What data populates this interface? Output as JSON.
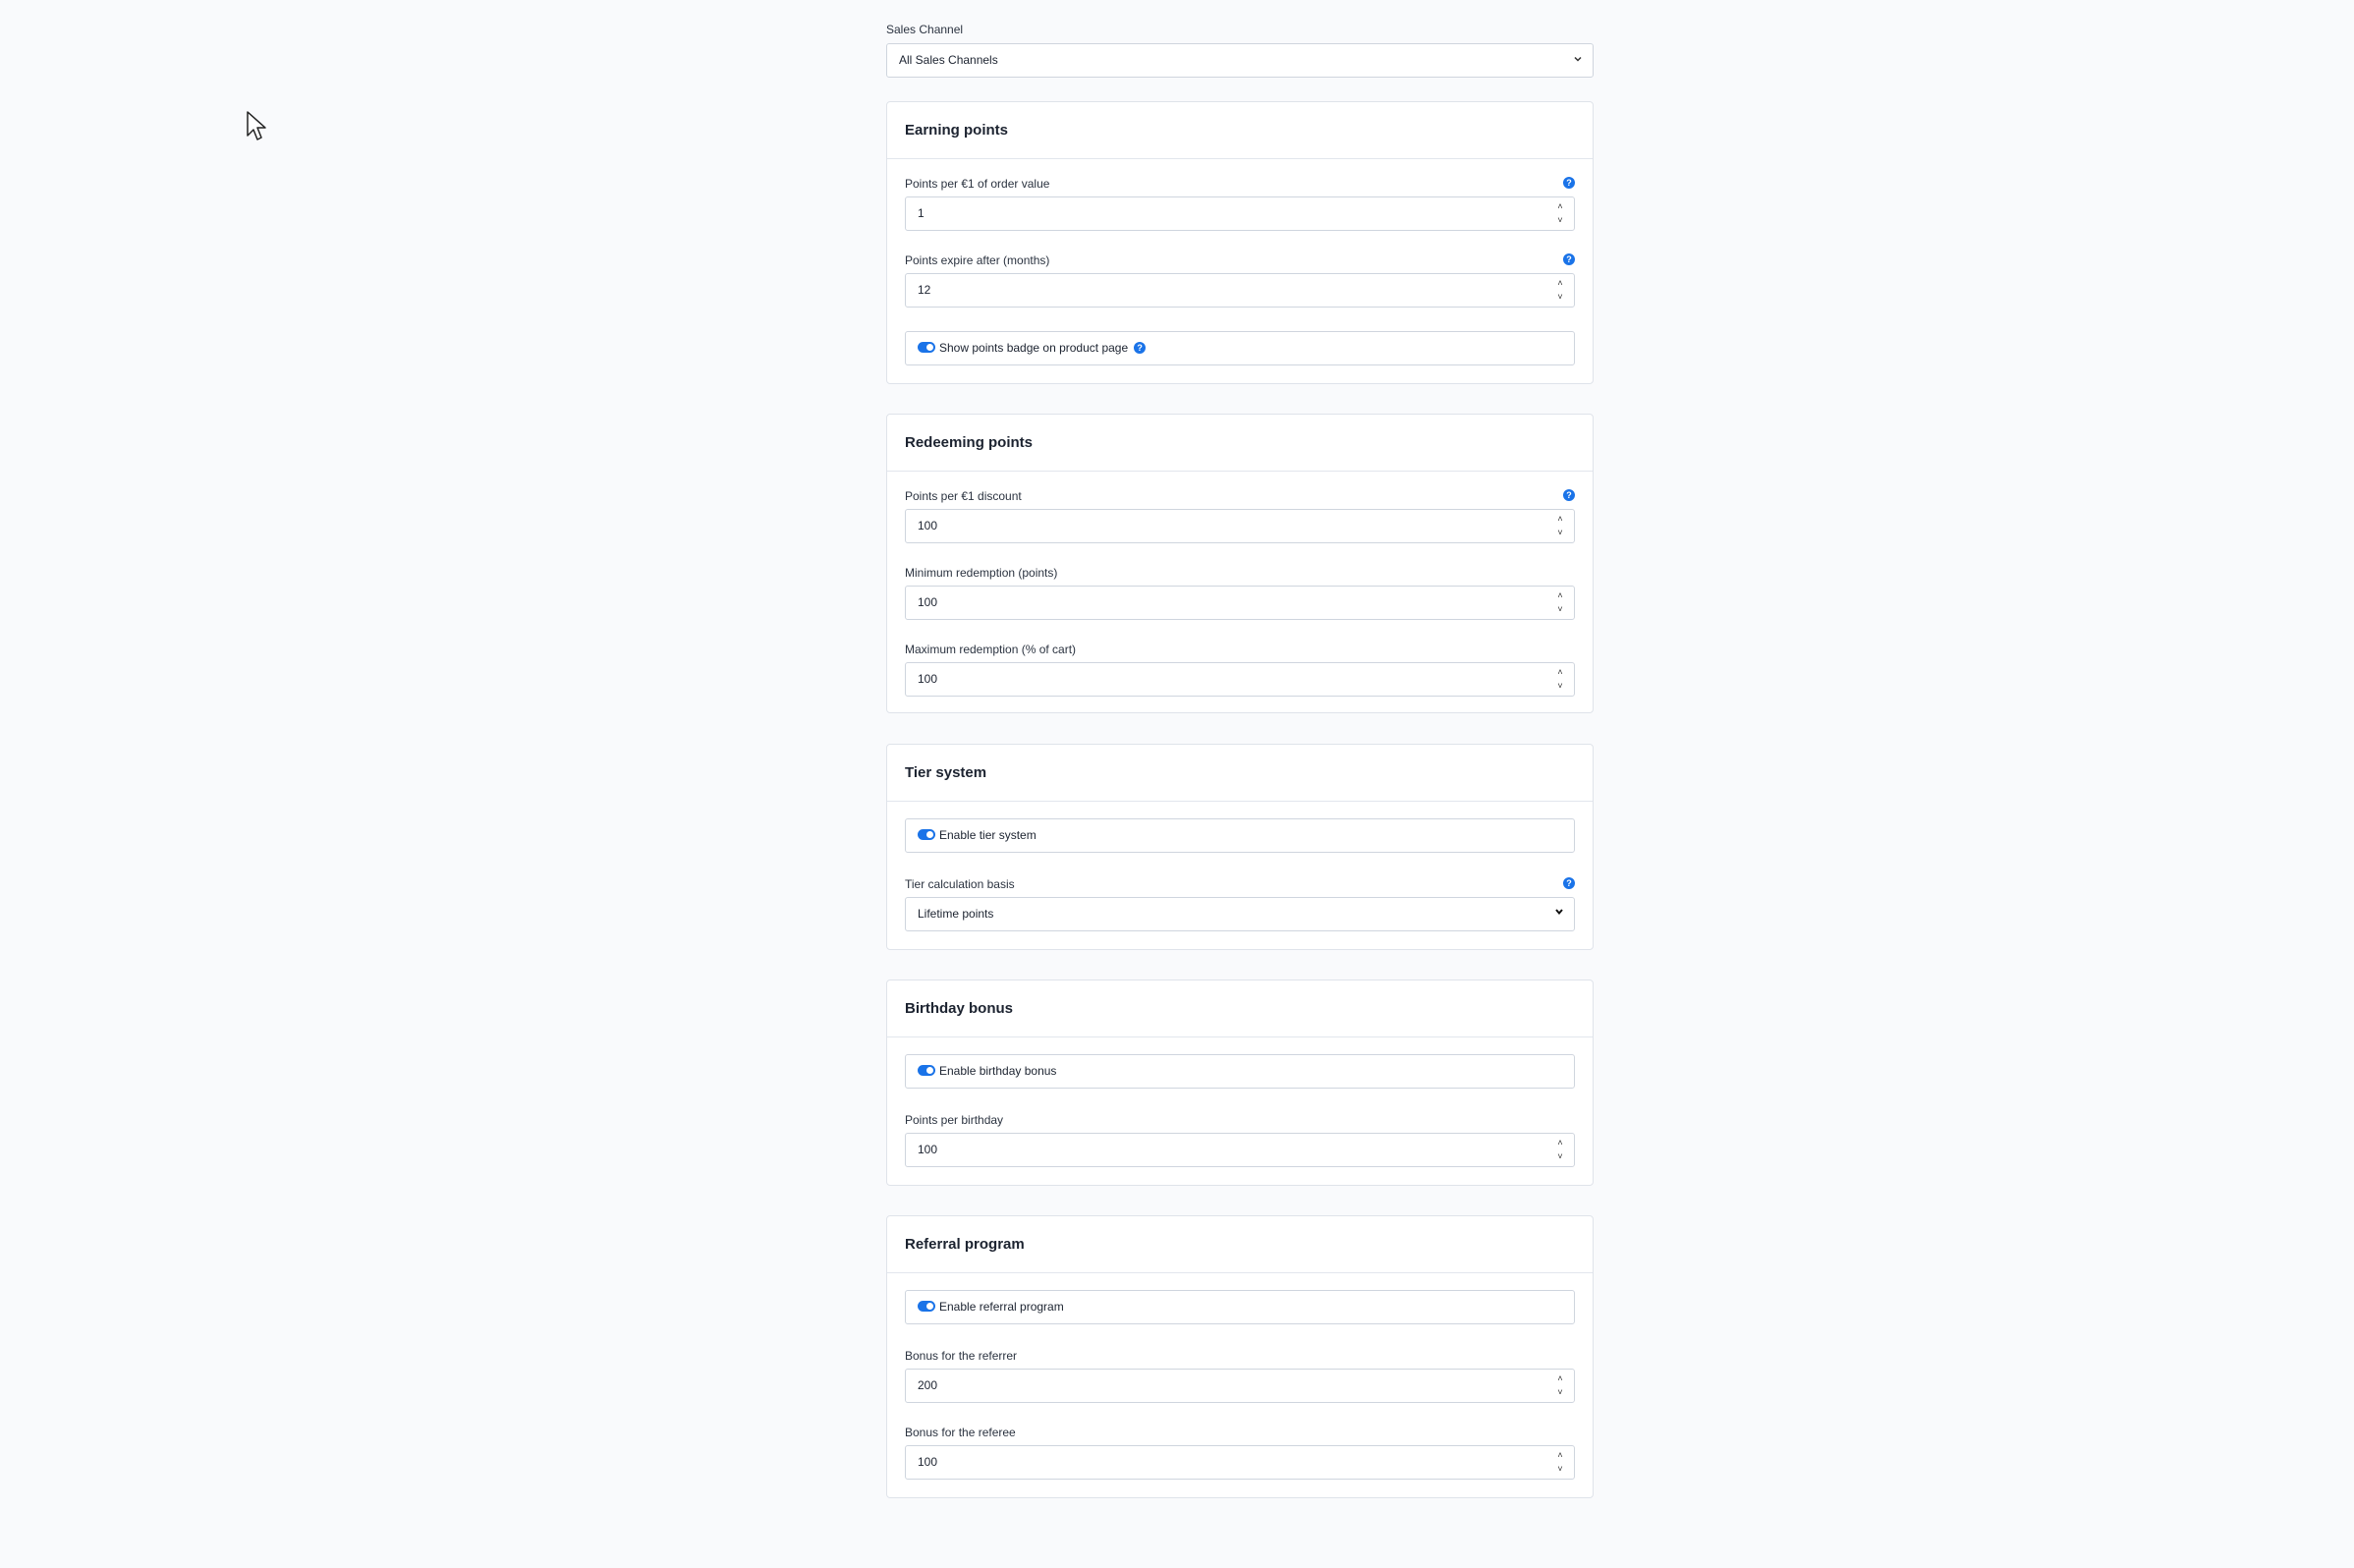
{
  "sales_channel": {
    "label": "Sales Channel",
    "value": "All Sales Channels"
  },
  "earning": {
    "title": "Earning points",
    "points_per_euro_label": "Points per €1 of order value",
    "points_per_euro_value": "1",
    "expire_label": "Points expire after (months)",
    "expire_value": "12",
    "badge_label": "Show points badge on product page"
  },
  "redeeming": {
    "title": "Redeeming points",
    "points_per_discount_label": "Points per €1 discount",
    "points_per_discount_value": "100",
    "min_label": "Minimum redemption (points)",
    "min_value": "100",
    "max_label": "Maximum redemption (% of cart)",
    "max_value": "100"
  },
  "tier": {
    "title": "Tier system",
    "enable_label": "Enable tier system",
    "basis_label": "Tier calculation basis",
    "basis_value": "Lifetime points"
  },
  "birthday": {
    "title": "Birthday bonus",
    "enable_label": "Enable birthday bonus",
    "points_label": "Points per birthday",
    "points_value": "100"
  },
  "referral": {
    "title": "Referral program",
    "enable_label": "Enable referral program",
    "referrer_label": "Bonus for the referrer",
    "referrer_value": "200",
    "referee_label": "Bonus for the referee",
    "referee_value": "100"
  },
  "icons": {
    "help": "?",
    "up": "˄",
    "down": "˅",
    "chevron": "⌄"
  },
  "colors": {
    "accent": "#1a73e8",
    "background": "#f9fafc"
  }
}
